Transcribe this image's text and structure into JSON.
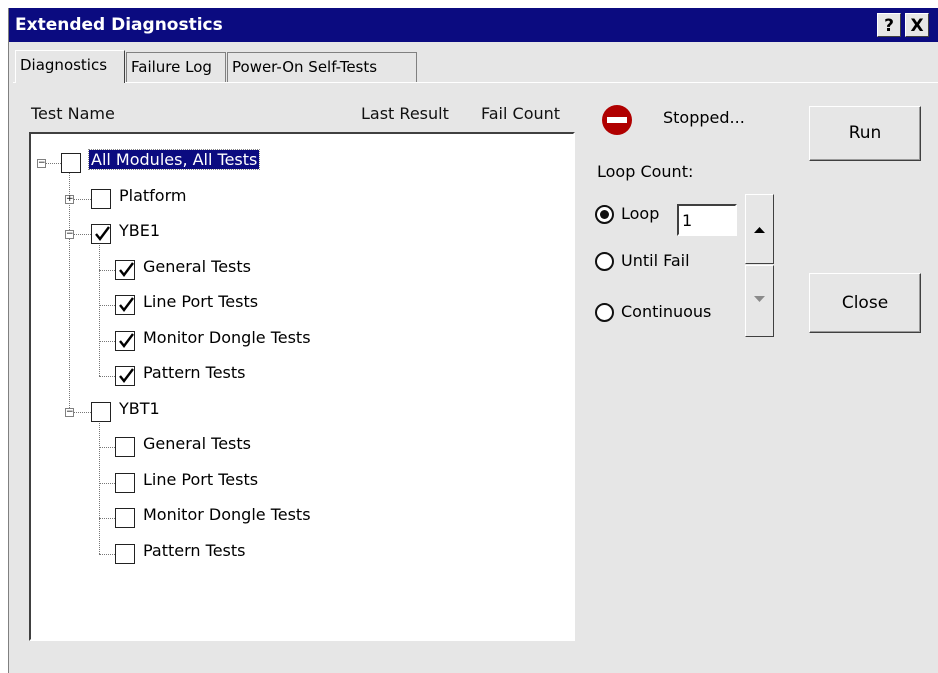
{
  "window": {
    "title": "Extended Diagnostics",
    "help_label": "?",
    "close_label": "X"
  },
  "tabs": [
    {
      "label": "Diagnostics"
    },
    {
      "label": "Failure Log"
    },
    {
      "label": "Power-On Self-Tests"
    }
  ],
  "columns": {
    "test_name": "Test Name",
    "last_result": "Last Result",
    "fail_count": "Fail Count"
  },
  "tree": [
    {
      "label": "All Modules, All Tests",
      "checked": false,
      "selected": true,
      "level": 0,
      "expander": "minus"
    },
    {
      "label": "Platform",
      "checked": false,
      "level": 1,
      "expander": "plus"
    },
    {
      "label": "YBE1",
      "checked": true,
      "level": 1,
      "expander": "minus"
    },
    {
      "label": "General Tests",
      "checked": true,
      "level": 2
    },
    {
      "label": "Line Port Tests",
      "checked": true,
      "level": 2
    },
    {
      "label": "Monitor Dongle Tests",
      "checked": true,
      "level": 2
    },
    {
      "label": "Pattern Tests",
      "checked": true,
      "level": 2
    },
    {
      "label": "YBT1",
      "checked": false,
      "level": 1,
      "expander": "minus"
    },
    {
      "label": "General Tests",
      "checked": false,
      "level": 2
    },
    {
      "label": "Line Port Tests",
      "checked": false,
      "level": 2
    },
    {
      "label": "Monitor Dongle Tests",
      "checked": false,
      "level": 2
    },
    {
      "label": "Pattern Tests",
      "checked": false,
      "level": 2
    }
  ],
  "status": {
    "text": "Stopped...",
    "icon": "stop-icon",
    "icon_color": "#b00000"
  },
  "loop": {
    "label": "Loop Count:",
    "options": [
      {
        "label": "Loop",
        "selected": true
      },
      {
        "label": "Until Fail",
        "selected": false
      },
      {
        "label": "Continuous",
        "selected": false
      }
    ],
    "value": "1"
  },
  "buttons": {
    "run": "Run",
    "close": "Close"
  }
}
